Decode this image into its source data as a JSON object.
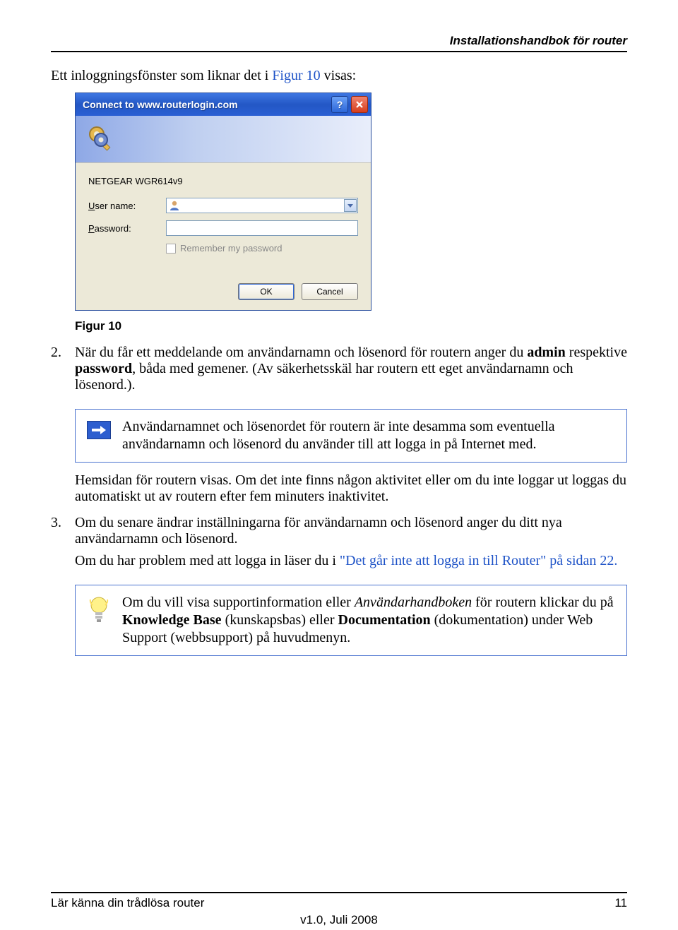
{
  "header": {
    "title": "Installationshandbok för router"
  },
  "intro": {
    "before": "Ett inloggningsfönster som liknar det i ",
    "figref": "Figur 10",
    "after": " visas:"
  },
  "dialog": {
    "title": "Connect to www.routerlogin.com",
    "device": "NETGEAR WGR614v9",
    "labels": {
      "username": "User name:",
      "password": "Password:",
      "remember": "Remember my password"
    },
    "values": {
      "username": "",
      "password": ""
    },
    "buttons": {
      "ok": "OK",
      "cancel": "Cancel"
    }
  },
  "caption": "Figur 10",
  "item2": {
    "marker": "2.",
    "p1a": "När du får ett meddelande om användarnamn och lösenord för routern anger du ",
    "p1admin": "admin",
    "p1b": " respektive ",
    "p1pwd": "password",
    "p1c": ", båda med gemener. (Av säkerhetsskäl har routern ett eget användarnamn och lösenord.)."
  },
  "note1": "Användarnamnet och lösenordet för routern är inte desamma som eventuella användarnamn och lösenord du använder till att logga in på Internet med.",
  "afterNote": "Hemsidan för routern visas. Om det inte finns någon aktivitet eller om du inte loggar ut loggas du automatiskt ut av routern efter fem minuters inaktivitet.",
  "item3": {
    "marker": "3.",
    "p1": "Om du senare ändrar inställningarna för användarnamn och lösenord anger du ditt nya användarnamn och lösenord.",
    "p2a": "Om du har problem med att logga in läser du i ",
    "p2link": "\"Det går inte att logga in till Router\" på sidan 22.",
    "p2b": ""
  },
  "note2": {
    "a": "Om du vill visa supportinformation eller ",
    "em": "Användarhandboken",
    "b": " för routern klickar du på ",
    "kb": "Knowledge Base",
    "c": " (kunskapsbas) eller ",
    "doc": "Documentation",
    "d": " (dokumentation) under Web Support (webbsupport) på huvudmenyn."
  },
  "footer": {
    "left": "Lär känna din trådlösa router",
    "right": "11",
    "center": "v1.0, Juli 2008"
  }
}
